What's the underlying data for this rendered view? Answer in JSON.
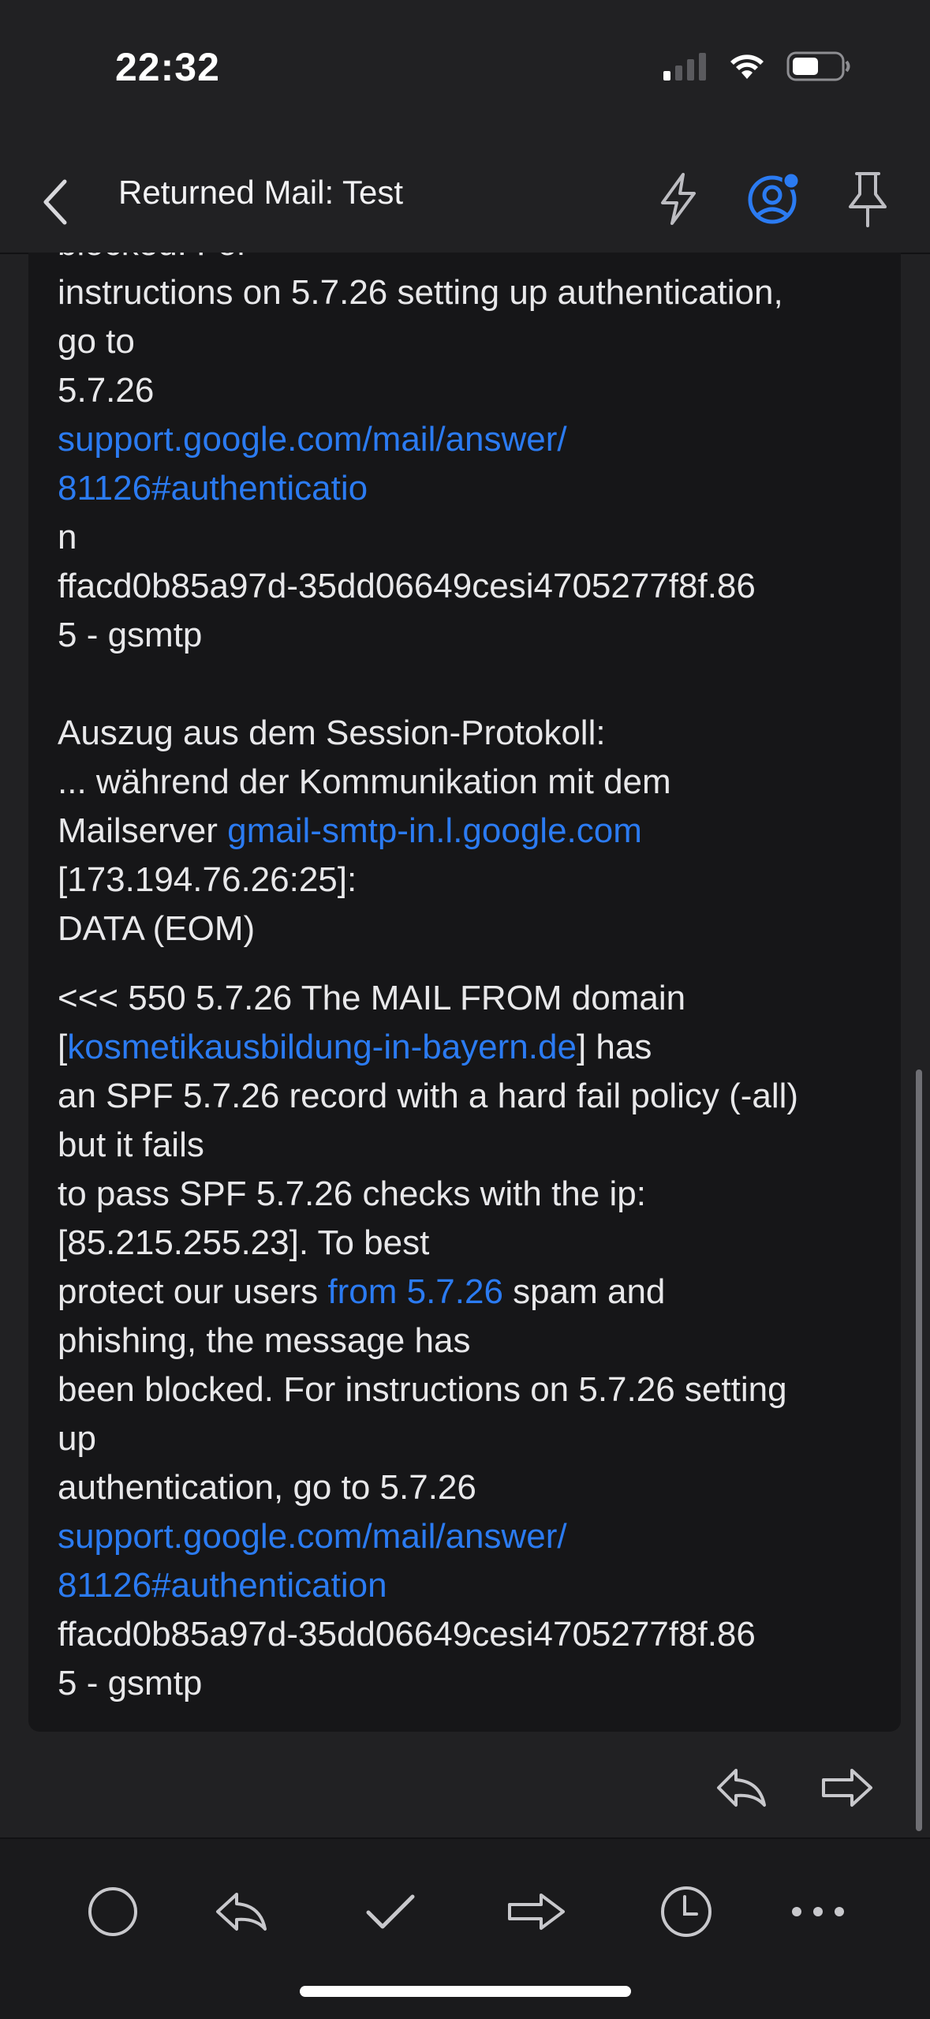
{
  "status": {
    "time": "22:32",
    "icons": [
      "cellular-signal-icon",
      "wifi-icon",
      "battery-icon"
    ]
  },
  "header": {
    "title": "Returned Mail: Test",
    "actions": [
      "back-icon",
      "lightning-icon",
      "account-icon",
      "pin-icon"
    ],
    "accent_color": "#2b7bf2"
  },
  "mail": {
    "lines": {
      "l0": "blocked. For",
      "l1": "instructions on 5.7.26 setting up authentication,",
      "l2": "go to",
      "l3": "5.7.26",
      "l4": "support.google.com/mail/answer/",
      "l5": "81126#authenticatio",
      "l6": "n",
      "l7": "ffacd0b85a97d-35dd06649cesi4705277f8f.86",
      "l8": "5 - gsmtp",
      "l9": "Auszug aus dem Session-Protokoll:",
      "l10": "... während der Kommunikation mit dem",
      "l11a": "Mailserver ",
      "l11b": "gmail-smtp-in.l.google.com",
      "l12": "[173.194.76.26:25]:",
      "l13": "DATA (EOM)",
      "l14": "<<< 550 5.7.26 The MAIL FROM domain",
      "l15a": "[",
      "l15b": "kosmetikausbildung-in-bayern.de",
      "l15c": "] has",
      "l16": "an SPF 5.7.26 record with a hard fail policy (-all)",
      "l17": "but it fails",
      "l18": "to pass SPF 5.7.26 checks with the ip:",
      "l19": "[85.215.255.23]. To best",
      "l20a": "protect our users ",
      "l20b": "from 5.7.26",
      "l20c": " spam and",
      "l21": "phishing, the message has",
      "l22": "been blocked. For instructions on 5.7.26 setting",
      "l23": "up",
      "l24": "authentication, go to 5.7.26",
      "l25": "support.google.com/mail/answer/",
      "l26": "81126#authentication",
      "l27": "ffacd0b85a97d-35dd06649cesi4705277f8f.86",
      "l28": "5 - gsmtp"
    }
  },
  "card_actions": [
    "reply-all-icon",
    "forward-icon"
  ],
  "toolbar": [
    "circle-icon",
    "reply-icon",
    "checkmark-icon",
    "forward-icon",
    "clock-icon",
    "more-icon"
  ]
}
